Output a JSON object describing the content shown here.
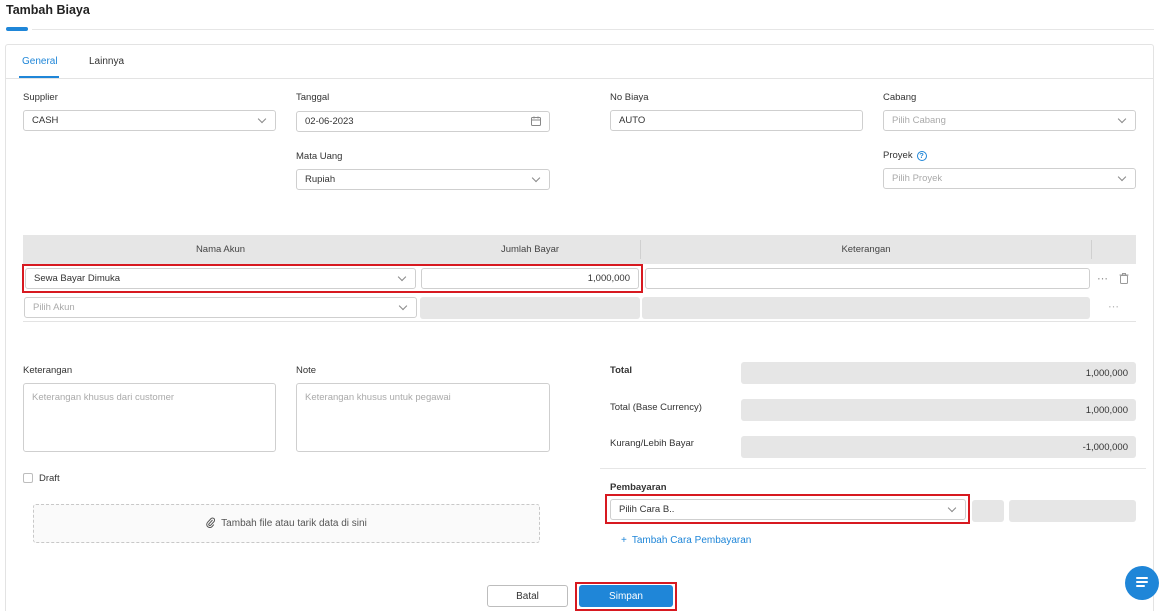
{
  "page": {
    "title": "Tambah Biaya"
  },
  "tabs": [
    {
      "label": "General",
      "active": true
    },
    {
      "label": "Lainnya",
      "active": false
    }
  ],
  "form": {
    "supplier": {
      "label": "Supplier",
      "value": "CASH"
    },
    "tanggal": {
      "label": "Tanggal",
      "value": "02-06-2023"
    },
    "no_biaya": {
      "label": "No Biaya",
      "value": "AUTO"
    },
    "cabang": {
      "label": "Cabang",
      "placeholder": "Pilih Cabang"
    },
    "mata_uang": {
      "label": "Mata Uang",
      "value": "Rupiah"
    },
    "proyek": {
      "label": "Proyek",
      "placeholder": "Pilih Proyek",
      "help_icon": "?"
    }
  },
  "table": {
    "headers": [
      "Nama Akun",
      "Jumlah Bayar",
      "Keterangan"
    ],
    "rows": [
      {
        "akun": "Sewa Bayar Dimuka",
        "jumlah": "1,000,000",
        "keterangan": ""
      }
    ],
    "new_row": {
      "akun_placeholder": "Pilih Akun"
    },
    "more_icon": "⋯",
    "delete_icon": "trash-icon"
  },
  "notes": {
    "keterangan": {
      "label": "Keterangan",
      "placeholder": "Keterangan khusus dari customer"
    },
    "note": {
      "label": "Note",
      "placeholder": "Keterangan khusus untuk pegawai"
    },
    "draft_label": "Draft",
    "attachment_label": "Tambah file atau tarik data di sini"
  },
  "summary": {
    "total": {
      "label": "Total",
      "value": "1,000,000"
    },
    "total_base": {
      "label": "Total (Base Currency)",
      "value": "1,000,000"
    },
    "kurang_lebih": {
      "label": "Kurang/Lebih Bayar",
      "value": "-1,000,000"
    }
  },
  "payment": {
    "label": "Pembayaran",
    "method_placeholder": "Pilih Cara B..",
    "add_label": "Tambah Cara Pembayaran",
    "add_icon": "+"
  },
  "actions": {
    "cancel": "Batal",
    "save": "Simpan"
  },
  "colors": {
    "accent": "#1f86d8",
    "highlight": "#d71920"
  }
}
